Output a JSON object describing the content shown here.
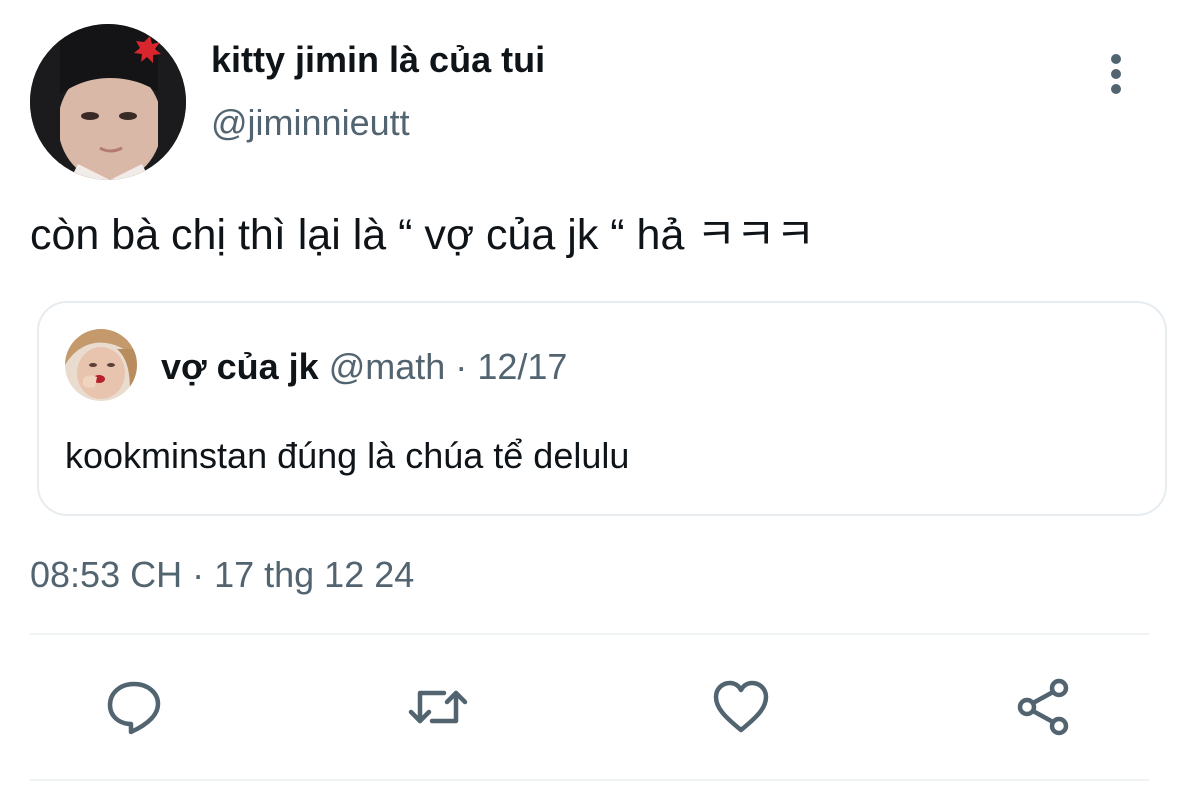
{
  "tweet": {
    "author": {
      "display_name": "kitty jimin là của tui",
      "handle": "@jiminnieutt",
      "avatar_icon": "avatar-photo"
    },
    "menu_icon": "more-vertical-icon",
    "text": "còn bà chị thì lại là “ vợ của jk “ hả ㅋㅋㅋ",
    "quoted": {
      "display_name": "vợ của jk",
      "handle": "@math",
      "separator": "·",
      "date": "12/17",
      "text": "kookminstan đúng là chúa tể delulu",
      "avatar_icon": "avatar-photo"
    },
    "timestamp": "08:53 CH · 17 thg 12 24",
    "actions": [
      {
        "name": "reply",
        "icon": "reply-icon"
      },
      {
        "name": "retweet",
        "icon": "retweet-icon"
      },
      {
        "name": "like",
        "icon": "heart-icon"
      },
      {
        "name": "share",
        "icon": "share-icon"
      }
    ]
  },
  "colors": {
    "primary_text": "#0f1419",
    "secondary_text": "#536471",
    "icon": "#536471",
    "border": "#e6ecf0",
    "background": "#ffffff"
  }
}
